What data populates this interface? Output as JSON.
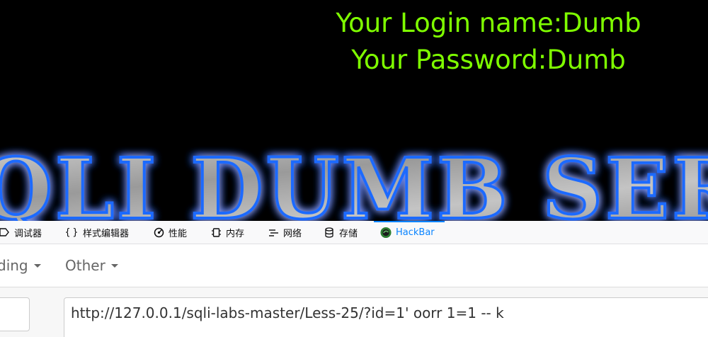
{
  "webpage": {
    "login_name_line": "Your Login name:Dumb",
    "password_line": "Your Password:Dumb",
    "banner_text": "SQLI DUMB SERIES"
  },
  "devtools": {
    "tabs": [
      {
        "label": "调试器",
        "icon": "debugger-icon"
      },
      {
        "label": "样式编辑器",
        "icon": "braces-icon"
      },
      {
        "label": "性能",
        "icon": "performance-icon"
      },
      {
        "label": "内存",
        "icon": "memory-icon"
      },
      {
        "label": "网络",
        "icon": "network-icon"
      },
      {
        "label": "存储",
        "icon": "storage-icon"
      },
      {
        "label": "HackBar",
        "icon": "hackbar-logo-icon",
        "active": true
      }
    ],
    "active_color": "#0a84ff"
  },
  "hackbar": {
    "menus": [
      {
        "label": "ding"
      },
      {
        "label": "Other"
      }
    ],
    "url_value": "http://127.0.0.1/sqli-labs-master/Less-25/?id=1' oorr 1=1 -- k"
  }
}
